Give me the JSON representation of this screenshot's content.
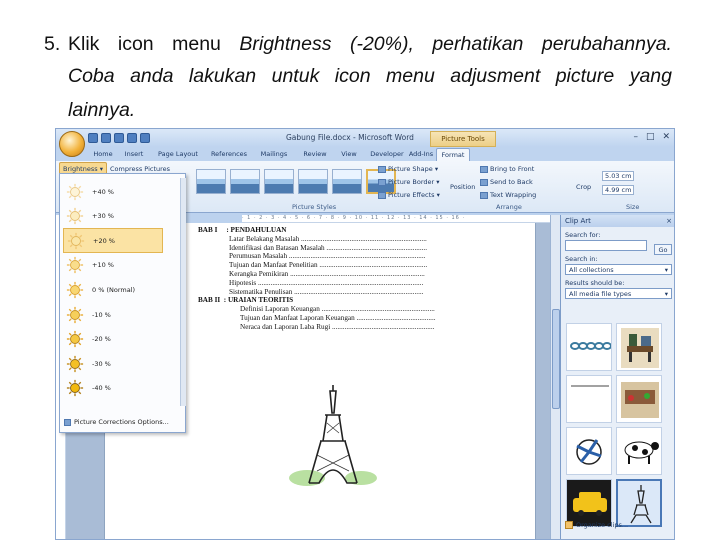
{
  "instruction": {
    "number": "5.",
    "line1_a": "Klik icon menu ",
    "line1_b": "Brightness (-20%), perhatikan perubahannya.",
    "line2": "Coba anda lakukan untuk icon menu adjusment picture yang",
    "line3": "lainnya."
  },
  "window": {
    "title": "Gabung File.docx - Microsoft Word",
    "context_tab": "Picture Tools",
    "minimize": "–",
    "maximize": "□",
    "close": "✕"
  },
  "ribbon_tabs": [
    "Home",
    "Insert",
    "Page Layout",
    "References",
    "Mailings",
    "Review",
    "View",
    "Developer",
    "Add-Ins",
    "Format"
  ],
  "ribbon": {
    "brightness_label": "Brightness",
    "compress_label": "Compress Pictures",
    "picture_styles_label": "Picture Styles",
    "picture_shape": "Picture Shape",
    "picture_border": "Picture Border",
    "picture_effects": "Picture Effects",
    "position": "Position",
    "bring_to_front": "Bring to Front",
    "send_to_back": "Send to Back",
    "text_wrapping": "Text Wrapping",
    "arrange_label": "Arrange",
    "crop": "Crop",
    "height_value": "5.03 cm",
    "width_value": "4.99 cm",
    "size_label": "Size"
  },
  "brightness_menu": {
    "items": [
      "+40 %",
      "+30 %",
      "+20 %",
      "+10 %",
      "0 % (Normal)",
      "-10 %",
      "-20 %",
      "-30 %",
      "-40 %"
    ],
    "selected_index": 2,
    "options_link": "Picture Corrections Options..."
  },
  "document": {
    "lines": [
      {
        "kind": "heading",
        "prefix": "BAB I",
        "text": ": PENDAHULUAN"
      },
      {
        "kind": "entry",
        "text": "Latar Belakang Masalah ......................................................................"
      },
      {
        "kind": "entry",
        "text": "Identifikasi dan Batasan Masalah ........................................................"
      },
      {
        "kind": "entry",
        "text": "Perumusan Masalah ............................................................................"
      },
      {
        "kind": "entry",
        "text": "Tujuan dan Manfaat Penelitian ............................................................"
      },
      {
        "kind": "entry",
        "text": "Kerangka Pemikiran ..........................................................................."
      },
      {
        "kind": "entry",
        "text": "Hipotesis ............................................................................................"
      },
      {
        "kind": "entry",
        "text": "Sistematika Penulisan ........................................................................"
      },
      {
        "kind": "heading",
        "prefix": "BAB II",
        "text": ": URAIAN TEORITIS"
      },
      {
        "kind": "entry2",
        "text": "Definisi Laporan Keuangan ..............................................................."
      },
      {
        "kind": "entry2",
        "text": "Tujuan dan Manfaat Laporan Keuangan ............................................"
      },
      {
        "kind": "entry2",
        "text": "Neraca dan Laporan Laba Rugi ........................................................."
      }
    ]
  },
  "clip_art": {
    "title": "Clip Art",
    "close": "×",
    "search_for_label": "Search for:",
    "search_value": "",
    "go_label": "Go",
    "search_in_label": "Search in:",
    "search_in_value": "All collections",
    "results_label": "Results should be:",
    "results_value": "All media file types",
    "organize": "Organize clips...",
    "thumb_icons": [
      "chain-clipart",
      "bench-clipart",
      "empty-clipart",
      "picnic-clipart",
      "fan-clipart",
      "cow-clipart",
      "taxi-clipart",
      "eiffel-tower-clipart"
    ]
  },
  "colors": {
    "ribbon_blue": "#bcd2ee",
    "selected_gallery": "#fbe3a4",
    "context_tab": "#edcf86"
  }
}
